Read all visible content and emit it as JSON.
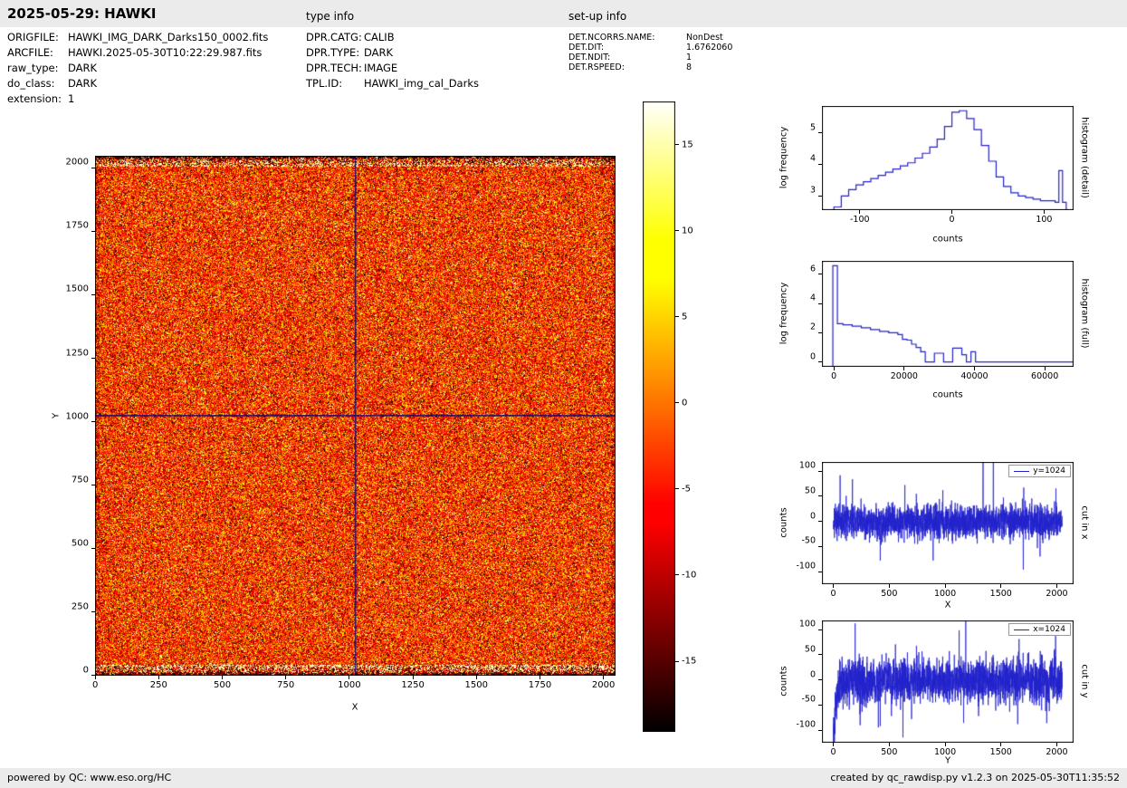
{
  "header": {
    "title": "2025-05-29: HAWKI",
    "type_info_label": "type info",
    "setup_info_label": "set-up info"
  },
  "file_info": {
    "rows": [
      {
        "label": "ORIGFILE:",
        "value": "HAWKI_IMG_DARK_Darks150_0002.fits"
      },
      {
        "label": "ARCFILE:",
        "value": "HAWKI.2025-05-30T10:22:29.987.fits"
      },
      {
        "label": "raw_type:",
        "value": "DARK"
      },
      {
        "label": "do_class:",
        "value": "DARK"
      },
      {
        "label": "extension:",
        "value": "1"
      }
    ]
  },
  "type_info": {
    "rows": [
      {
        "label": "DPR.CATG:",
        "value": "CALIB"
      },
      {
        "label": "DPR.TYPE:",
        "value": "DARK"
      },
      {
        "label": "DPR.TECH:",
        "value": "IMAGE"
      },
      {
        "label": "TPL.ID:",
        "value": "HAWKI_img_cal_Darks"
      }
    ]
  },
  "setup_info": {
    "rows": [
      {
        "label": "DET.NCORRS.NAME:",
        "value": "NonDest"
      },
      {
        "label": "DET.DIT:",
        "value": "1.6762060"
      },
      {
        "label": "DET.NDIT:",
        "value": "1"
      },
      {
        "label": "DET.RSPEED:",
        "value": "8"
      }
    ]
  },
  "footer": {
    "left": "powered by QC: www.eso.org/HC",
    "right": "created by qc_rawdisp.py v1.2.3 on 2025-05-30T11:35:52"
  },
  "colors": {
    "plot_line": "#2222cc",
    "crosshair": "#000080",
    "header_bg": "#ebebeb"
  },
  "chart_data": [
    {
      "type": "heatmap",
      "name": "raw dark frame",
      "xlabel": "X",
      "ylabel": "Y",
      "xlim": [
        -0.5,
        2047.5
      ],
      "ylim": [
        -0.5,
        2047.5
      ],
      "xticks": [
        0,
        250,
        500,
        750,
        1000,
        1250,
        1500,
        1750,
        2000
      ],
      "yticks": [
        0,
        250,
        500,
        750,
        1000,
        1250,
        1500,
        1750,
        2000
      ],
      "crosshair_x": 1024,
      "crosshair_y": 1024,
      "colormap": "hot",
      "noise_seed": 42,
      "colorbar": {
        "vmin": -19.1,
        "vmax": 17.5,
        "ticks": [
          15,
          10,
          5,
          0,
          -5,
          -10,
          -15
        ]
      }
    },
    {
      "type": "line",
      "subtype": "step_histogram",
      "right_label": "histogram (detail)",
      "xlabel": "counts",
      "ylabel": "log frequency",
      "xlim": [
        -141,
        132
      ],
      "ylim": [
        2.55,
        5.85
      ],
      "xticks": [
        -100,
        0,
        100
      ],
      "yticks": [
        3,
        4,
        5
      ],
      "x": [
        -128,
        -120,
        -112,
        -104,
        -96,
        -88,
        -80,
        -72,
        -64,
        -56,
        -48,
        -40,
        -32,
        -24,
        -16,
        -8,
        0,
        8,
        16,
        24,
        32,
        40,
        48,
        56,
        64,
        72,
        80,
        88,
        96,
        104,
        112,
        116,
        120
      ],
      "y": [
        2.65,
        3.0,
        3.2,
        3.35,
        3.45,
        3.55,
        3.65,
        3.75,
        3.85,
        3.95,
        4.05,
        4.2,
        4.35,
        4.55,
        4.8,
        5.2,
        5.65,
        5.7,
        5.45,
        5.1,
        4.6,
        4.1,
        3.6,
        3.3,
        3.1,
        3.0,
        2.95,
        2.9,
        2.85,
        2.85,
        2.8,
        3.8,
        2.8
      ]
    },
    {
      "type": "line",
      "subtype": "step_histogram",
      "right_label": "histogram (full)",
      "xlabel": "counts",
      "ylabel": "log frequency",
      "xlim": [
        -3400,
        68200
      ],
      "ylim": [
        -0.33,
        6.93
      ],
      "xticks": [
        0,
        20000,
        40000,
        60000
      ],
      "yticks": [
        0,
        2,
        4,
        6
      ],
      "x": [
        -300,
        1000,
        2600,
        5200,
        7800,
        10400,
        13000,
        15600,
        18200,
        19500,
        20800,
        22100,
        23400,
        24700,
        26000,
        28600,
        29900,
        31200,
        33800,
        35100,
        36400,
        37700,
        39000,
        40300,
        65500
      ],
      "y": [
        6.6,
        2.62,
        2.55,
        2.45,
        2.35,
        2.22,
        2.1,
        2.0,
        1.88,
        1.55,
        1.5,
        1.22,
        1.0,
        0.7,
        0.0,
        0.6,
        0.6,
        0.0,
        0.95,
        0.95,
        0.5,
        0.0,
        0.7,
        0.0,
        0.0
      ]
    },
    {
      "type": "line",
      "subtype": "cut",
      "legend": "y=1024",
      "right_label": "cut in x",
      "xlabel": "X",
      "ylabel": "counts",
      "xlim": [
        -102,
        2150
      ],
      "ylim": [
        -125,
        118
      ],
      "xticks": [
        0,
        500,
        1000,
        1500,
        2000
      ],
      "yticks": [
        -100,
        -50,
        0,
        50,
        100
      ],
      "noise": {
        "seed": 7,
        "n": 2048,
        "mean": 0,
        "std": 17,
        "spikes": [
          [
            640,
            72
          ],
          [
            980,
            62
          ],
          [
            1340,
            300
          ],
          [
            1432,
            300
          ],
          [
            420,
            -78
          ],
          [
            1700,
            -96
          ],
          [
            1850,
            -70
          ]
        ]
      }
    },
    {
      "type": "line",
      "subtype": "cut",
      "legend": "x=1024",
      "right_label": "cut in y",
      "xlabel": "Y",
      "ylabel": "counts",
      "xlim": [
        -102,
        2150
      ],
      "ylim": [
        -125,
        118
      ],
      "xticks": [
        0,
        500,
        1000,
        1500,
        2000
      ],
      "yticks": [
        -100,
        -50,
        0,
        50,
        100
      ],
      "noise": {
        "seed": 13,
        "n": 2048,
        "mean": -3,
        "std": 22,
        "start_dip": {
          "n": 60,
          "depth": -115
        },
        "spikes": [
          [
            195,
            112
          ],
          [
            1185,
            116
          ],
          [
            520,
            -72
          ],
          [
            700,
            -78
          ],
          [
            1300,
            -72
          ],
          [
            1650,
            -88
          ],
          [
            1900,
            -62
          ]
        ]
      }
    }
  ]
}
